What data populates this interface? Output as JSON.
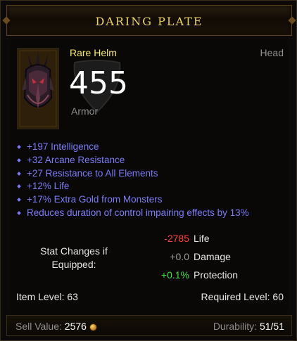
{
  "item": {
    "name": "DARING PLATE",
    "rarity": "Rare Helm",
    "slot": "Head",
    "armor_value": "455",
    "armor_label": "Armor",
    "icon": "demon-helm-icon"
  },
  "affixes": [
    "+197 Intelligence",
    "+32 Arcane Resistance",
    "+27 Resistance to All Elements",
    "+12% Life",
    "+17% Extra Gold from Monsters",
    "Reduces duration of control impairing effects by 13%"
  ],
  "stat_changes": {
    "label_line1": "Stat Changes if",
    "label_line2": "Equipped:",
    "rows": [
      {
        "value": "-2785",
        "name": "Life",
        "color": "#ff4040"
      },
      {
        "value": "+0.0",
        "name": "Damage",
        "color": "#9a9a9a"
      },
      {
        "value": "+0.1%",
        "name": "Protection",
        "color": "#40e040"
      }
    ]
  },
  "levels": {
    "item_level": "Item Level: 63",
    "required_level": "Required Level: 60"
  },
  "footer": {
    "sell_label": "Sell Value: ",
    "sell_value": "2576",
    "sell_icon": "gold-coin-icon",
    "durability_label": "Durability: ",
    "durability_value": "51/51"
  },
  "colors": {
    "title": "#e8d36a",
    "rare": "#f5e66c",
    "affix": "#7a7cf6"
  }
}
